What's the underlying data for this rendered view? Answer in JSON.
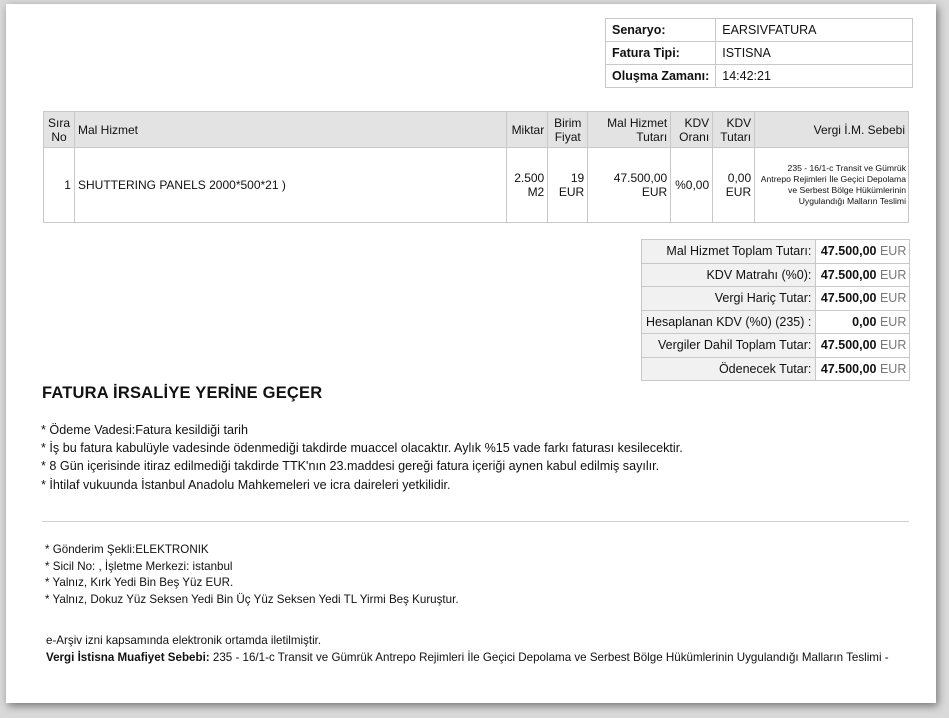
{
  "scenario": {
    "rows": [
      {
        "label": "Senaryo:",
        "value": "EARSIVFATURA"
      },
      {
        "label": "Fatura Tipi:",
        "value": "ISTISNA"
      },
      {
        "label": "Oluşma Zamanı:",
        "value": "14:42:21"
      }
    ]
  },
  "items": {
    "headers": {
      "sira_no": "Sıra No",
      "mal_hizmet": "Mal Hizmet",
      "miktar": "Miktar",
      "birim_fiyat": "Birim Fiyat",
      "tutar": "Mal Hizmet Tutarı",
      "kdv_orani": "KDV Oranı",
      "kdv_tutari": "KDV Tutarı",
      "vergi_sebebi": "Vergi İ.M. Sebebi"
    },
    "rows": [
      {
        "sira_no": "1",
        "mal_hizmet": "SHUTTERING PANELS 2000*500*21 )",
        "miktar": "2.500 M2",
        "birim_fiyat": "19 EUR",
        "tutar": "47.500,00 EUR",
        "kdv_orani": "%0,00",
        "kdv_tutari": "0,00 EUR",
        "vergi_sebebi": "235 - 16/1-c Transit ve Gümrük Antrepo Rejimleri İle Geçici Depolama ve Serbest Bölge Hükümlerinin Uygulandığı Malların Teslimi"
      }
    ]
  },
  "totals": {
    "currency": "EUR",
    "rows": [
      {
        "label": "Mal Hizmet Toplam Tutarı:",
        "value": "47.500,00"
      },
      {
        "label": "KDV Matrahı (%0):",
        "value": "47.500,00"
      },
      {
        "label": "Vergi Hariç Tutar:",
        "value": "47.500,00"
      },
      {
        "label": "Hesaplanan KDV (%0) (235) :",
        "value": "0,00"
      },
      {
        "label": "Vergiler Dahil Toplam Tutar:",
        "value": "47.500,00"
      },
      {
        "label": "Ödenecek Tutar:",
        "value": "47.500,00"
      }
    ]
  },
  "title": "FATURA İRSALİYE YERİNE GEÇER",
  "notes": [
    "* Ödeme Vadesi:Fatura kesildiği tarih",
    "* İş bu fatura kabulüyle vadesinde ödenmediği takdirde muaccel olacaktır. Aylık %15 vade farkı faturası kesilecektir.",
    "* 8 Gün içerisinde itiraz edilmediği takdirde TTK'nın 23.maddesi gereği fatura içeriği aynen kabul edilmiş sayılır.",
    "* İhtilaf vukuunda İstanbul Anadolu Mahkemeleri ve icra daireleri yetkilidir."
  ],
  "notes2": [
    "* Gönderim Şekli:ELEKTRONIK",
    "* Sicil No: , İşletme Merkezi: istanbul",
    "* Yalnız, Kırk Yedi Bin Beş Yüz EUR.",
    "* Yalnız, Dokuz Yüz Seksen Yedi Bin Üç Yüz Seksen Yedi TL Yirmi Beş Kuruştur."
  ],
  "footer": {
    "earsiv_note": "e-Arşiv izni kapsamında elektronik ortamda iletilmiştir.",
    "exemption_label": "Vergi İstisna Muafiyet Sebebi:",
    "exemption_text": " 235 - 16/1-c Transit ve Gümrük Antrepo Rejimleri İle Geçici Depolama ve Serbest Bölge Hükümlerinin Uygulandığı Malların Teslimi -"
  }
}
